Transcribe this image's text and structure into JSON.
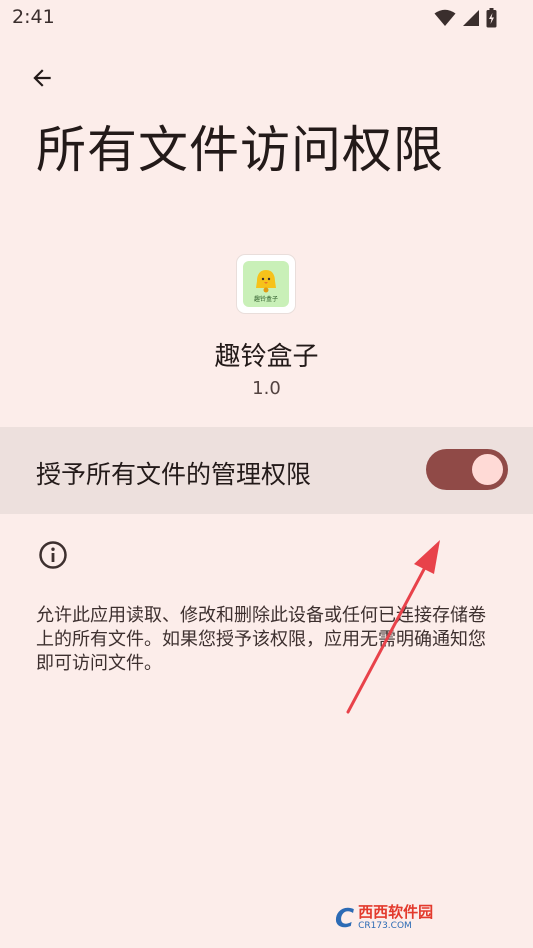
{
  "status_bar": {
    "time": "2:41",
    "icons": [
      "wifi-icon",
      "signal-icon",
      "battery-charging-icon"
    ]
  },
  "header": {
    "back_icon": "arrow-left-icon",
    "title": "所有文件访问权限"
  },
  "app": {
    "icon": "app-bell-icon",
    "icon_caption": "趣铃盒子",
    "name": "趣铃盒子",
    "version": "1.0"
  },
  "permission_toggle": {
    "label": "授予所有文件的管理权限",
    "enabled": true
  },
  "info": {
    "icon": "info-icon",
    "description": "允许此应用读取、修改和删除此设备或任何已连接存储卷上的所有文件。如果您授予该权限，应用无需明确通知您即可访问文件。"
  },
  "watermark": {
    "logo": "C",
    "main": "西西软件园",
    "sub": "CR173.COM"
  },
  "colors": {
    "background": "#fcedea",
    "row_background": "#ede0dd",
    "switch_track": "#904a47",
    "switch_thumb": "#ffdad6",
    "annotation_arrow": "#e8424a"
  }
}
